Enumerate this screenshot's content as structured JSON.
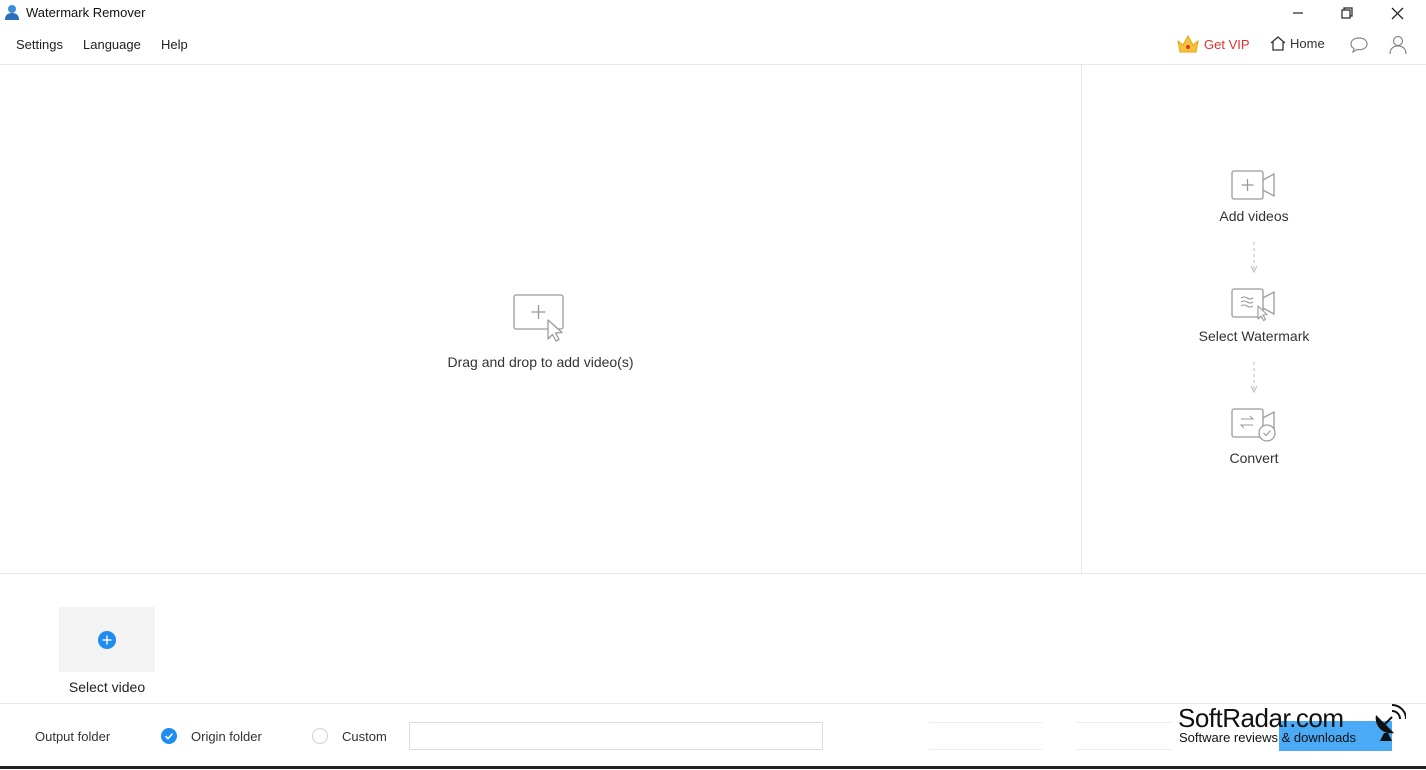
{
  "window": {
    "title": "Watermark Remover"
  },
  "menu": {
    "items": [
      "Settings",
      "Language",
      "Help"
    ],
    "vip_label": "Get VIP",
    "home_label": "Home"
  },
  "dropzone": {
    "label": "Drag and drop to add video(s)"
  },
  "steps": [
    {
      "label": "Add videos",
      "icon": "add-video-icon"
    },
    {
      "label": "Select Watermark",
      "icon": "select-watermark-icon"
    },
    {
      "label": "Convert",
      "icon": "convert-icon"
    }
  ],
  "select_video": {
    "label": "Select video"
  },
  "output": {
    "label": "Output folder",
    "origin_label": "Origin folder",
    "custom_label": "Custom",
    "path_value": "",
    "selected": "origin"
  },
  "watermark": {
    "title": "SoftRadar.com",
    "subtitle": "Software reviews & downloads"
  },
  "colors": {
    "accent": "#1e8cf0",
    "vip": "#e0322e",
    "button": "#4aaaf5"
  }
}
